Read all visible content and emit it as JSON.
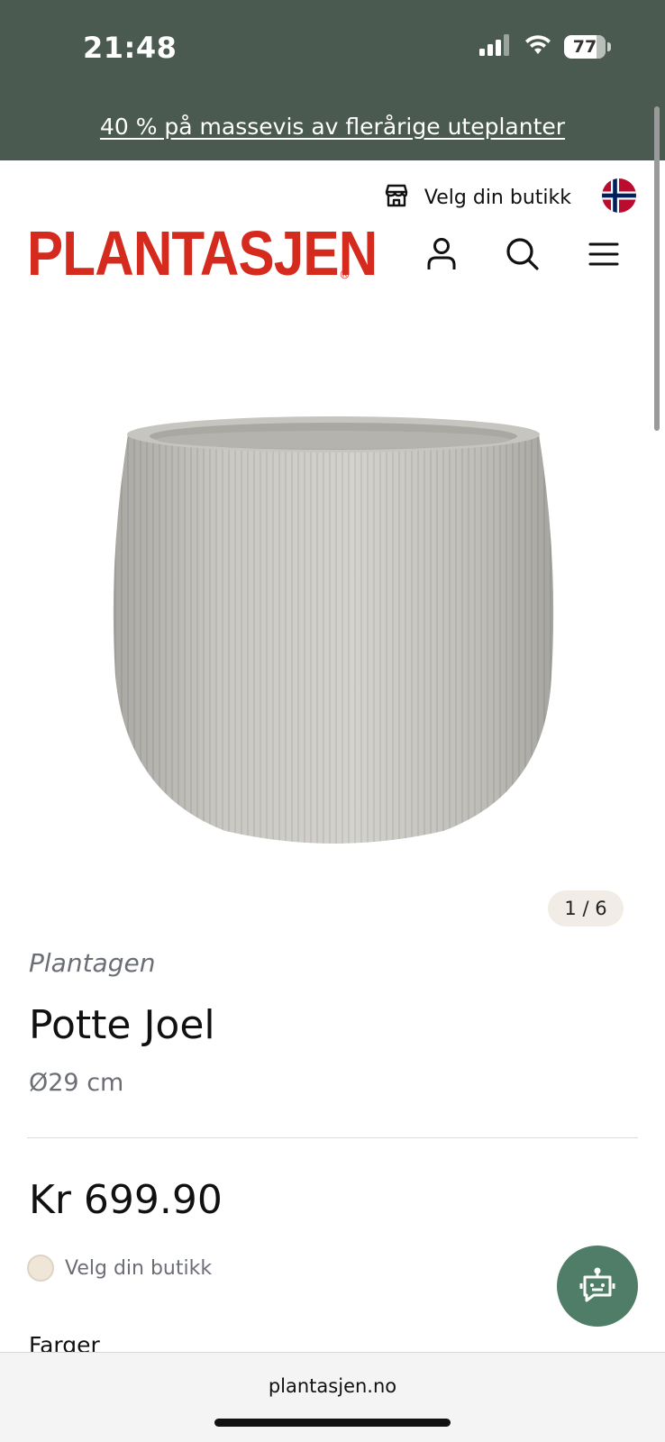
{
  "status_bar": {
    "time": "21:48",
    "battery": "77"
  },
  "promo": {
    "text": "40 % på massevis av flerårige uteplanter"
  },
  "header": {
    "store_label": "Velg din butikk",
    "logo_text": "PLANTASJEN",
    "logo_mark": "®",
    "icons": [
      "store-icon",
      "norway-flag-icon",
      "account-icon",
      "search-icon",
      "menu-icon"
    ]
  },
  "product": {
    "image_counter": "1 / 6",
    "brand": "Plantagen",
    "title": "Potte Joel",
    "size": "Ø29 cm",
    "price": "Kr 699.90",
    "store_pick": "Velg din butikk",
    "colors_heading": "Farger"
  },
  "browser": {
    "url": "plantasjen.no"
  },
  "colors": {
    "top_bar": "#4a5a50",
    "logo_red": "#d52b1e",
    "chat_button": "#4f7d67"
  }
}
